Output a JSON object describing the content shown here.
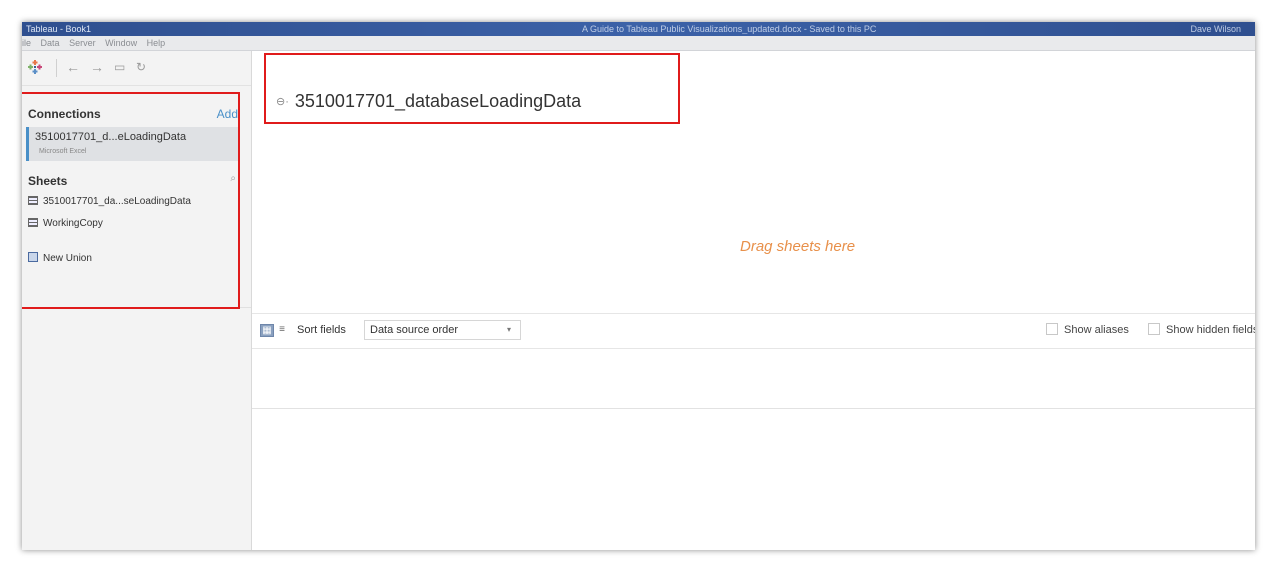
{
  "window": {
    "title": "Tableau - Book1",
    "doc_title": "A Guide to Tableau Public Visualizations_updated.docx - Saved to this PC",
    "user": "Dave Wilson"
  },
  "menu": {
    "items": [
      "ile",
      "Data",
      "Server",
      "Window",
      "Help"
    ]
  },
  "toolbar": {
    "back_icon": "←",
    "forward_icon": "→",
    "save_icon": "▭",
    "refresh_icon": "↻"
  },
  "connections": {
    "title": "Connections",
    "add_label": "Add",
    "items": [
      {
        "name": "3510017701_d...eLoadingData",
        "type": "Microsoft Excel"
      }
    ]
  },
  "sheets": {
    "title": "Sheets",
    "search_icon": "⌕",
    "items": [
      {
        "label": "3510017701_da...seLoadingData"
      },
      {
        "label": "WorkingCopy"
      }
    ],
    "new_union_label": "New Union"
  },
  "canvas": {
    "data_source_name": "3510017701_databaseLoadingData",
    "db_icon": "⊖·",
    "drag_hint": "Drag sheets here"
  },
  "grid_toolbar": {
    "sort_label": "Sort fields",
    "sort_value": "Data source order",
    "caret": "▾",
    "show_aliases": "Show aliases",
    "show_hidden": "Show hidden fields"
  },
  "colors": {
    "accent": "#4a90c8",
    "drag_hint": "#e8904a",
    "annotation": "#e01b1b"
  }
}
